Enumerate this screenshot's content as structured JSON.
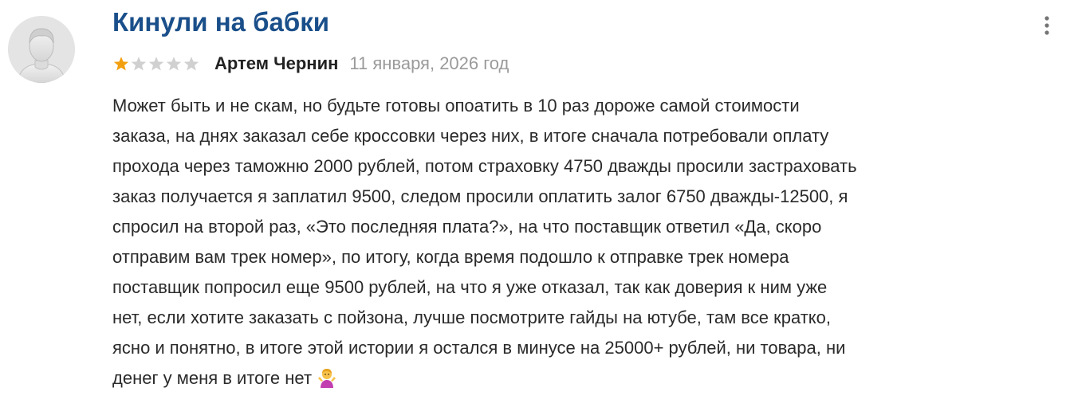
{
  "review": {
    "title": "Кинули на бабки",
    "rating": 1,
    "rating_max": 5,
    "author": "Артем Чернин",
    "date": "11 января, 2026 год",
    "body_lines": [
      "Может быть и не скам, но будьте готовы опоатить в 10 раз дороже самой стоимости",
      "заказа, на днях заказал себе кроссовки через них, в итоге сначала потребовали оплату",
      "прохода через таможню 2000 рублей, потом страховку 4750 дважды просили застраховать",
      "заказ получается я заплатил 9500, следом просили оплатить залог 6750 дважды-12500, я",
      "спросил на второй раз, «Это последняя плата?», на что поставщик ответил «Да, скоро",
      "отправим вам трек номер», по итогу, когда время подошло к отправке трек номера",
      "поставщик попросил еще 9500 рублей, на что я уже отказал, так как доверия к ним уже",
      "нет, если хотите заказать с пойзона, лучше посмотрите гайды на ютубе, там все кратко,",
      "ясно и понятно, в итоге этой истории я остался в минусе на 25000+ рублей, ни товара, ни",
      "денег у меня в итоге нет"
    ]
  },
  "icons": {
    "avatar": "user-avatar-placeholder",
    "menu": "more-vertical-icon",
    "star_filled": "star-filled-icon",
    "star_empty": "star-empty-icon",
    "emoji": "person-shrugging-emoji"
  },
  "colors": {
    "title": "#1a4f8a",
    "star_filled": "#f2a010",
    "star_empty": "#d0d0d0",
    "date": "#9a9a9a",
    "text": "#2a2a2a"
  }
}
